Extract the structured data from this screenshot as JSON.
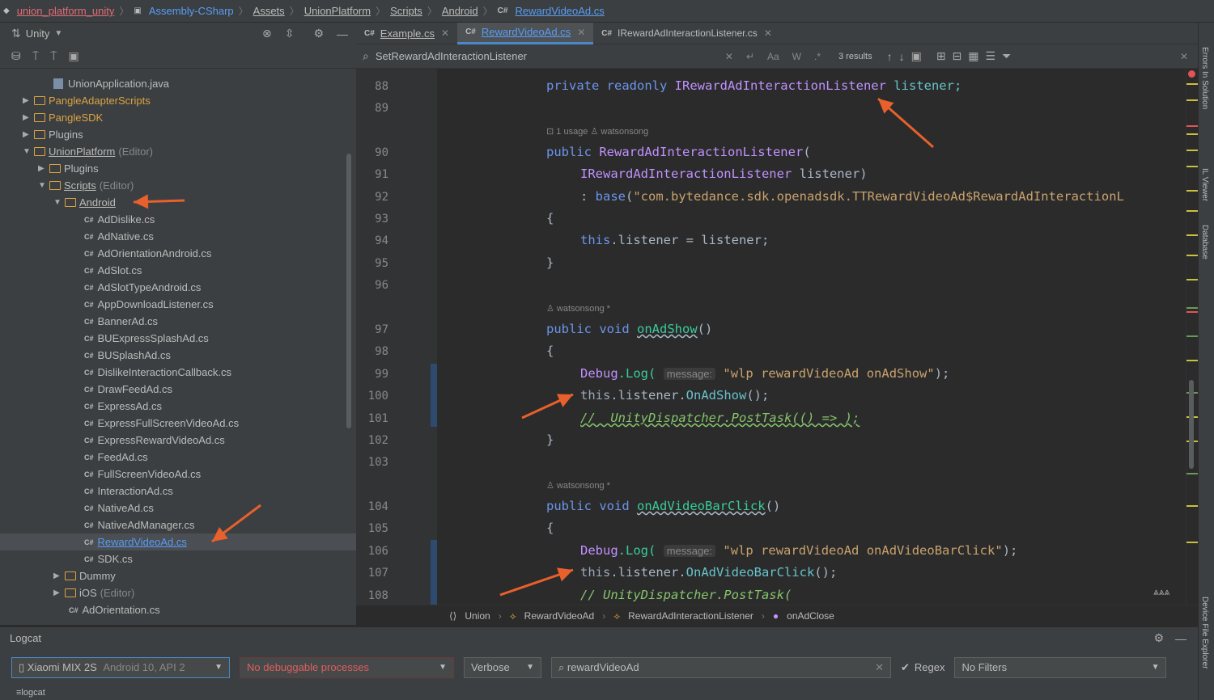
{
  "breadcrumb": [
    "union_platform_unity",
    "Assembly-CSharp",
    "Assets",
    "UnionPlatform",
    "Scripts",
    "Android",
    "RewardVideoAd.cs"
  ],
  "project": {
    "title": "Unity",
    "items": [
      {
        "label": "UnionApplication.java",
        "indent": 3,
        "kind": "file"
      },
      {
        "label": "PangleAdapterScripts",
        "indent": 1,
        "kind": "folder",
        "arrow": "▶",
        "color": "orange"
      },
      {
        "label": "PangleSDK",
        "indent": 1,
        "kind": "folder",
        "arrow": "▶",
        "color": "orange"
      },
      {
        "label": "Plugins",
        "indent": 1,
        "kind": "folder",
        "arrow": "▶"
      },
      {
        "label": "UnionPlatform",
        "indent": 1,
        "kind": "folder",
        "arrow": "▼",
        "extra": "(Editor)",
        "underline": true
      },
      {
        "label": "Plugins",
        "indent": 2,
        "kind": "folder",
        "arrow": "▶"
      },
      {
        "label": "Scripts",
        "indent": 2,
        "kind": "folder",
        "arrow": "▼",
        "extra": "(Editor)",
        "underline": true
      },
      {
        "label": "Android",
        "indent": 3,
        "kind": "folder",
        "arrow": "▼",
        "underline": true
      },
      {
        "label": "AdDislike.cs",
        "indent": 5,
        "kind": "cs"
      },
      {
        "label": "AdNative.cs",
        "indent": 5,
        "kind": "cs"
      },
      {
        "label": "AdOrientationAndroid.cs",
        "indent": 5,
        "kind": "cs"
      },
      {
        "label": "AdSlot.cs",
        "indent": 5,
        "kind": "cs"
      },
      {
        "label": "AdSlotTypeAndroid.cs",
        "indent": 5,
        "kind": "cs"
      },
      {
        "label": "AppDownloadListener.cs",
        "indent": 5,
        "kind": "cs"
      },
      {
        "label": "BannerAd.cs",
        "indent": 5,
        "kind": "cs"
      },
      {
        "label": "BUExpressSplashAd.cs",
        "indent": 5,
        "kind": "cs"
      },
      {
        "label": "BUSplashAd.cs",
        "indent": 5,
        "kind": "cs"
      },
      {
        "label": "DislikeInteractionCallback.cs",
        "indent": 5,
        "kind": "cs"
      },
      {
        "label": "DrawFeedAd.cs",
        "indent": 5,
        "kind": "cs"
      },
      {
        "label": "ExpressAd.cs",
        "indent": 5,
        "kind": "cs"
      },
      {
        "label": "ExpressFullScreenVideoAd.cs",
        "indent": 5,
        "kind": "cs"
      },
      {
        "label": "ExpressRewardVideoAd.cs",
        "indent": 5,
        "kind": "cs"
      },
      {
        "label": "FeedAd.cs",
        "indent": 5,
        "kind": "cs"
      },
      {
        "label": "FullScreenVideoAd.cs",
        "indent": 5,
        "kind": "cs"
      },
      {
        "label": "InteractionAd.cs",
        "indent": 5,
        "kind": "cs"
      },
      {
        "label": "NativeAd.cs",
        "indent": 5,
        "kind": "cs"
      },
      {
        "label": "NativeAdManager.cs",
        "indent": 5,
        "kind": "cs"
      },
      {
        "label": "RewardVideoAd.cs",
        "indent": 5,
        "kind": "cs",
        "selected": true
      },
      {
        "label": "SDK.cs",
        "indent": 5,
        "kind": "cs"
      },
      {
        "label": "Dummy",
        "indent": 3,
        "kind": "folder",
        "arrow": "▶"
      },
      {
        "label": "iOS",
        "indent": 3,
        "kind": "folder",
        "arrow": "▶",
        "extra": "(Editor)"
      },
      {
        "label": "AdOrientation.cs",
        "indent": 4,
        "kind": "cs"
      }
    ]
  },
  "tabs": [
    {
      "label": "Example.cs",
      "active": false
    },
    {
      "label": "RewardVideoAd.cs",
      "active": true
    },
    {
      "label": "IRewardAdInteractionListener.cs",
      "active": false
    }
  ],
  "search": {
    "value": "SetRewardAdInteractionListener",
    "results": "3 results"
  },
  "code": {
    "line_numbers": [
      "88",
      "89",
      "90",
      "91",
      "92",
      "93",
      "94",
      "95",
      "96",
      "97",
      "98",
      "99",
      "100",
      "101",
      "102",
      "103",
      "104",
      "105",
      "106",
      "107",
      "108"
    ],
    "hint_usage": "1 usage",
    "hint_author": "watsonsong",
    "hint_author_mod": "watsonsong *",
    "l88_kw": "private readonly",
    "l88_type": "IRewardAdInteractionListener",
    "l88_rest": " listener;",
    "l90_kw": "public",
    "l90_name": "RewardAdInteractionListener",
    "l90_rest": "(",
    "l91_type": "IRewardAdInteractionListener",
    "l91_rest": " listener)",
    "l92_a": ": ",
    "l92_kw": "base",
    "l92_b": "(",
    "l92_str": "\"com.bytedance.sdk.openadsdk.TTRewardVideoAd$RewardAdInteractionL",
    "l93": "{",
    "l94_kw": "this",
    "l94_rest": ".listener = listener;",
    "l95": "}",
    "l97_kw": "public void",
    "l97_name": "onAdShow",
    "l97_rest": "()",
    "l98": "{",
    "l99_cls": "Debug",
    "l99_m": ".Log(",
    "l99_label": "message:",
    "l99_str": "\"wlp rewardVideoAd onAdShow\"",
    "l99_end": ");",
    "l100_kw": "this",
    "l100_a": ".listener.",
    "l100_m": "OnAdShow",
    "l100_end": "();",
    "l101_cm": "//  UnityDispatcher.PostTask(() => );",
    "l102": "}",
    "l104_kw": "public void",
    "l104_name": "onAdVideoBarClick",
    "l104_rest": "()",
    "l105": "{",
    "l106_cls": "Debug",
    "l106_m": ".Log(",
    "l106_label": "message:",
    "l106_str": "\"wlp rewardVideoAd onAdVideoBarClick\"",
    "l106_end": ");",
    "l107_kw": "this",
    "l107_a": ".listener.",
    "l107_m": "OnAdVideoBarClick",
    "l107_end": "();",
    "l108_cm": "// UnityDispatcher.PostTask("
  },
  "editor_breadcrumb": [
    "Union",
    "RewardVideoAd",
    "RewardAdInteractionListener",
    "onAdClose"
  ],
  "logcat": {
    "title": "Logcat",
    "device": "Xiaomi MIX 2S",
    "device_extra": "Android 10, API 2",
    "process": "No debuggable processes",
    "level": "Verbose",
    "filter": "rewardVideoAd",
    "regex_label": "Regex",
    "filters": "No Filters",
    "footer": "logcat"
  },
  "right_strip": [
    "Errors In Solution",
    "IL Viewer",
    "Database",
    "Device File Explorer"
  ],
  "colors": {
    "accent": "#4a88c7",
    "arrow": "#e8602c",
    "keyword": "#6c95eb",
    "type": "#c191ff"
  }
}
